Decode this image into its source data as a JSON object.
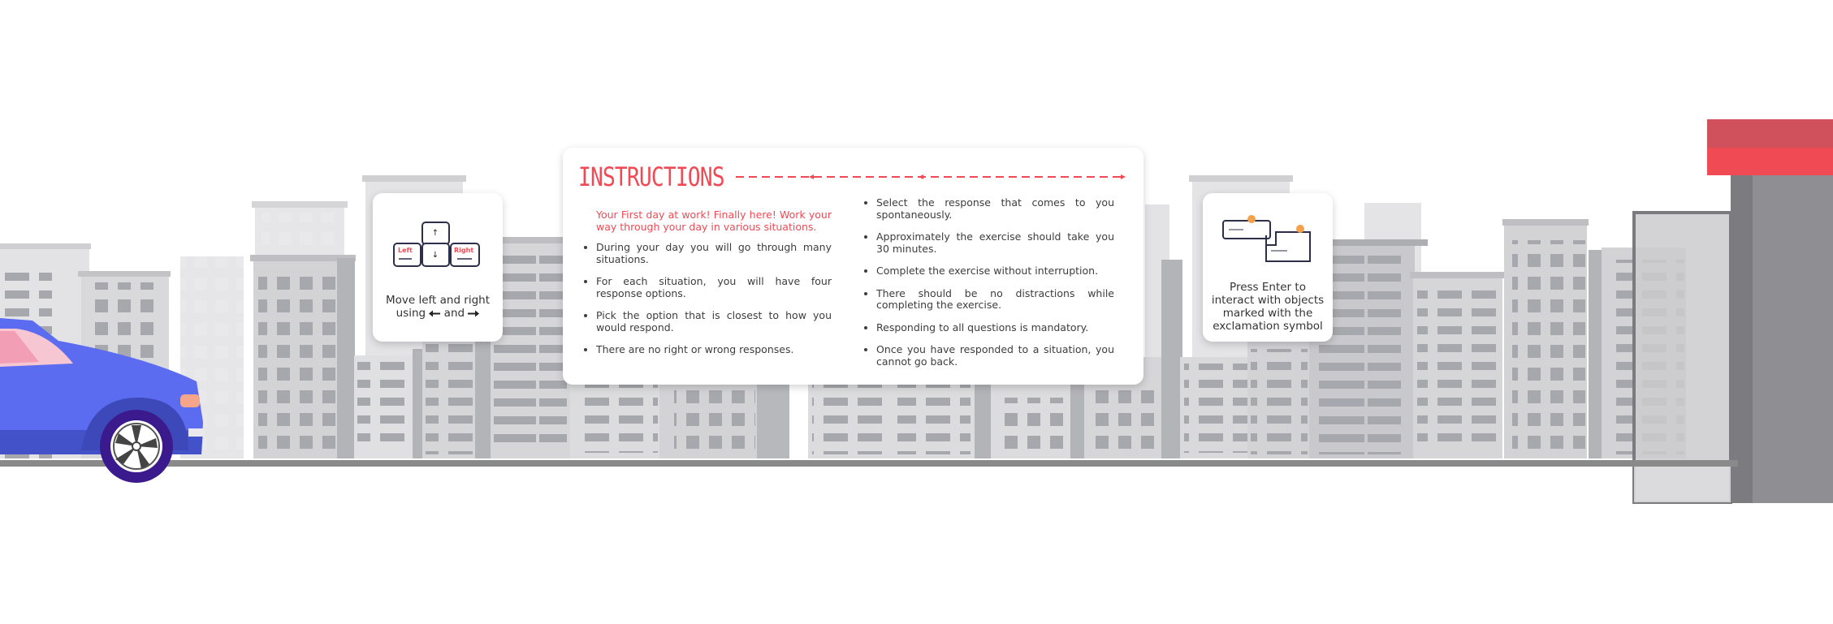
{
  "controls_card": {
    "keys": {
      "left": "Left",
      "up": "↑",
      "down": "↓",
      "right": "Right"
    },
    "hint_line1": "Move left and right",
    "hint_using": "using",
    "hint_and": "and"
  },
  "enter_card": {
    "hint": "Press Enter to interact with objects marked with the exclamation symbol"
  },
  "instructions": {
    "title": "INSTRUCTIONS",
    "intro": "Your First day at work! Finally here! Work your way through your day in various situations.",
    "left_items": [
      "During your day you will go through many situations.",
      "For each situation, you will have four response options.",
      "Pick the option that is closest to how you would respond.",
      "There are no right or wrong responses."
    ],
    "right_items": [
      "Select the response that comes to you spontaneously.",
      "Approximately the exercise should take you 30 minutes.",
      "Complete the exercise without interruption.",
      "There should be no distractions while completing the exercise.",
      "Responding to all questions is mandatory.",
      "Once you have responded to a situation, you cannot go back."
    ]
  },
  "colors": {
    "accent": "#f04a55",
    "car_body": "#5b6cf0",
    "car_tire": "#3a1a8c",
    "building_light": "#dcdcde",
    "building_mid": "#c6c6c9",
    "window": "#a7a8ad",
    "road": "#8a8a8a",
    "sign_red": "#f04a55"
  }
}
